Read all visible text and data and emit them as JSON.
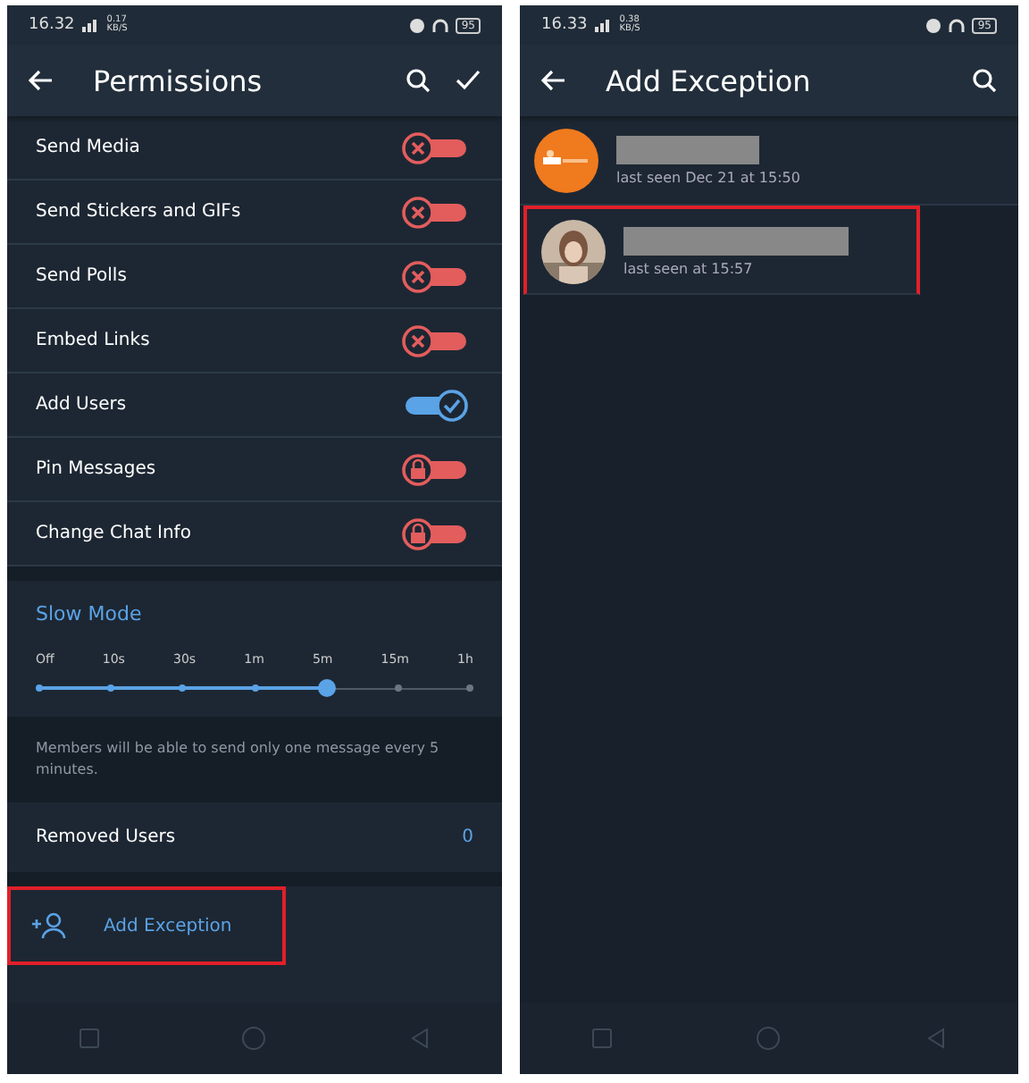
{
  "left_screen": {
    "status_bar": {
      "time": "16.32",
      "speed": "0.17",
      "speed_unit": "KB/S",
      "battery": "95"
    },
    "header": {
      "title": "Permissions"
    },
    "permissions": [
      {
        "label": "Send Media",
        "checked": false,
        "locked": false
      },
      {
        "label": "Send Stickers and GIFs",
        "checked": false,
        "locked": false
      },
      {
        "label": "Send Polls",
        "checked": false,
        "locked": false
      },
      {
        "label": "Embed Links",
        "checked": false,
        "locked": false
      },
      {
        "label": "Add Users",
        "checked": true,
        "locked": false
      },
      {
        "label": "Pin Messages",
        "checked": false,
        "locked": true
      },
      {
        "label": "Change Chat Info",
        "checked": false,
        "locked": true
      }
    ],
    "slow_mode": {
      "title": "Slow Mode",
      "ticks": [
        "Off",
        "10s",
        "30s",
        "1m",
        "5m",
        "15m",
        "1h"
      ],
      "level": 0.667,
      "hint": "Members will be able to send only one message every 5 minutes."
    },
    "removed_users": {
      "label": "Removed Users",
      "count": "0"
    },
    "add_exception": {
      "label": "Add Exception",
      "highlighted": true
    }
  },
  "right_screen": {
    "status_bar": {
      "time": "16.33",
      "speed": "0.38",
      "speed_unit": "KB/S",
      "battery": "95"
    },
    "header": {
      "title": "Add Exception"
    },
    "contacts": [
      {
        "kind": "picture",
        "status": "last seen Dec 21 at 15:50",
        "highlighted": false
      },
      {
        "kind": "picture",
        "status": "last seen at 15:57",
        "highlighted": true
      }
    ]
  }
}
